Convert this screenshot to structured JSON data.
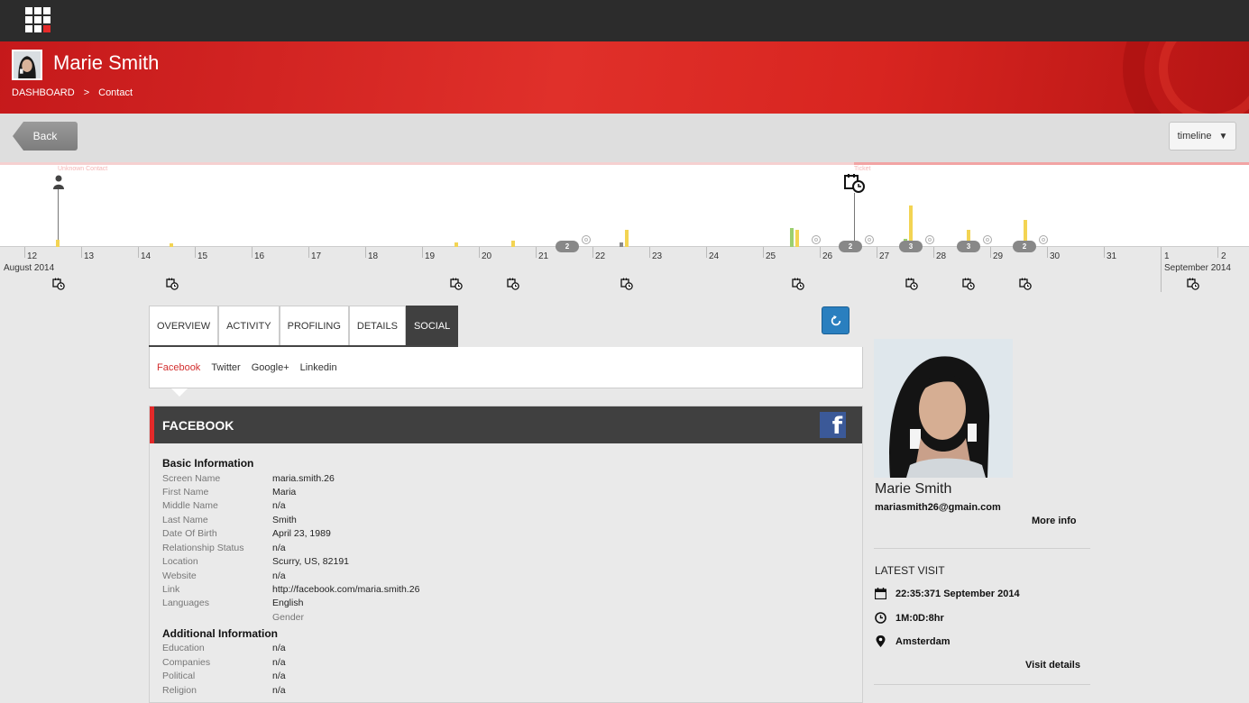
{
  "app": {
    "logo_icon": "apps-grid-icon",
    "accent": "#e42a2a"
  },
  "header": {
    "title": "Marie Smith",
    "breadcrumb": [
      "DASHBOARD",
      "Contact"
    ],
    "breadcrumb_sep": ">"
  },
  "toolbar": {
    "back_label": "Back",
    "view_select": "timeline"
  },
  "timeline": {
    "labels": {
      "start": "Unknown Contact",
      "ticket": "Ticket"
    },
    "days": [
      "12",
      "13",
      "14",
      "15",
      "16",
      "17",
      "18",
      "19",
      "20",
      "21",
      "22",
      "23",
      "24",
      "25",
      "26",
      "27",
      "28",
      "29",
      "30",
      "31",
      "1",
      "2"
    ],
    "months": [
      "August 2014",
      "September 2014"
    ],
    "pills": [
      "2",
      "2",
      "3",
      "3",
      "2"
    ]
  },
  "tabs": [
    {
      "label": "OVERVIEW"
    },
    {
      "label": "ACTIVITY"
    },
    {
      "label": "PROFILING"
    },
    {
      "label": "DETAILS"
    },
    {
      "label": "SOCIAL",
      "active": true
    }
  ],
  "subtabs": [
    {
      "label": "Facebook",
      "active": true
    },
    {
      "label": "Twitter"
    },
    {
      "label": "Google+"
    },
    {
      "label": "Linkedin"
    }
  ],
  "facebook": {
    "title": "FACEBOOK",
    "basic_title": "Basic Information",
    "basic": [
      {
        "label": "Screen Name",
        "value": "maria.smith.26"
      },
      {
        "label": "First Name",
        "value": "Maria"
      },
      {
        "label": "Middle Name",
        "value": "n/a"
      },
      {
        "label": "Last Name",
        "value": "Smith"
      },
      {
        "label": "Date Of Birth",
        "value": "April 23, 1989"
      },
      {
        "label": "Relationship Status",
        "value": "n/a"
      },
      {
        "label": "Location",
        "value": "Scurry, US, 82191"
      },
      {
        "label": "Website",
        "value": "n/a"
      },
      {
        "label": "Link",
        "value": "http://facebook.com/maria.smith.26"
      },
      {
        "label": "Languages",
        "value": "English"
      },
      {
        "label": "",
        "value": "Gender"
      }
    ],
    "additional_title": "Additional Information",
    "additional": [
      {
        "label": "Education",
        "value": "n/a"
      },
      {
        "label": "Companies",
        "value": "n/a"
      },
      {
        "label": "Political",
        "value": "n/a"
      },
      {
        "label": "Religion",
        "value": "n/a"
      }
    ]
  },
  "profile": {
    "name": "Marie Smith",
    "email": "mariasmith26@gmain.com",
    "more_info": "More info",
    "latest_visit_title": "LATEST VISIT",
    "visit_datetime": "22:35:371 September 2014",
    "visit_duration": "1M:0D:8hr",
    "visit_location": "Amsterdam",
    "visit_details": "Visit details"
  }
}
